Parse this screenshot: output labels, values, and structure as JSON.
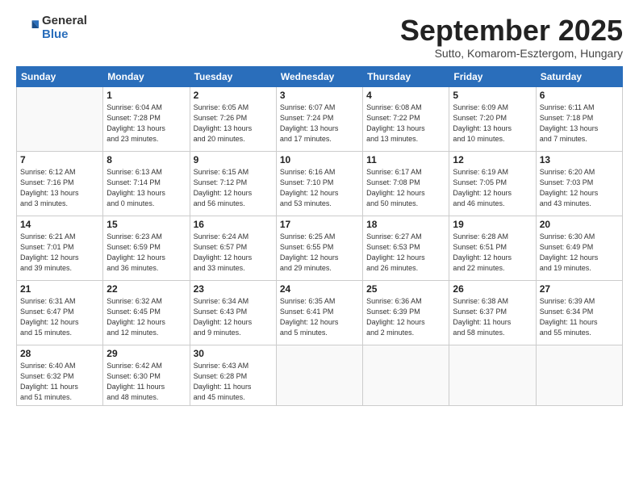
{
  "header": {
    "logo_general": "General",
    "logo_blue": "Blue",
    "month_title": "September 2025",
    "subtitle": "Sutto, Komarom-Esztergom, Hungary"
  },
  "days_of_week": [
    "Sunday",
    "Monday",
    "Tuesday",
    "Wednesday",
    "Thursday",
    "Friday",
    "Saturday"
  ],
  "weeks": [
    [
      {
        "day": "",
        "info": ""
      },
      {
        "day": "1",
        "info": "Sunrise: 6:04 AM\nSunset: 7:28 PM\nDaylight: 13 hours\nand 23 minutes."
      },
      {
        "day": "2",
        "info": "Sunrise: 6:05 AM\nSunset: 7:26 PM\nDaylight: 13 hours\nand 20 minutes."
      },
      {
        "day": "3",
        "info": "Sunrise: 6:07 AM\nSunset: 7:24 PM\nDaylight: 13 hours\nand 17 minutes."
      },
      {
        "day": "4",
        "info": "Sunrise: 6:08 AM\nSunset: 7:22 PM\nDaylight: 13 hours\nand 13 minutes."
      },
      {
        "day": "5",
        "info": "Sunrise: 6:09 AM\nSunset: 7:20 PM\nDaylight: 13 hours\nand 10 minutes."
      },
      {
        "day": "6",
        "info": "Sunrise: 6:11 AM\nSunset: 7:18 PM\nDaylight: 13 hours\nand 7 minutes."
      }
    ],
    [
      {
        "day": "7",
        "info": "Sunrise: 6:12 AM\nSunset: 7:16 PM\nDaylight: 13 hours\nand 3 minutes."
      },
      {
        "day": "8",
        "info": "Sunrise: 6:13 AM\nSunset: 7:14 PM\nDaylight: 13 hours\nand 0 minutes."
      },
      {
        "day": "9",
        "info": "Sunrise: 6:15 AM\nSunset: 7:12 PM\nDaylight: 12 hours\nand 56 minutes."
      },
      {
        "day": "10",
        "info": "Sunrise: 6:16 AM\nSunset: 7:10 PM\nDaylight: 12 hours\nand 53 minutes."
      },
      {
        "day": "11",
        "info": "Sunrise: 6:17 AM\nSunset: 7:08 PM\nDaylight: 12 hours\nand 50 minutes."
      },
      {
        "day": "12",
        "info": "Sunrise: 6:19 AM\nSunset: 7:05 PM\nDaylight: 12 hours\nand 46 minutes."
      },
      {
        "day": "13",
        "info": "Sunrise: 6:20 AM\nSunset: 7:03 PM\nDaylight: 12 hours\nand 43 minutes."
      }
    ],
    [
      {
        "day": "14",
        "info": "Sunrise: 6:21 AM\nSunset: 7:01 PM\nDaylight: 12 hours\nand 39 minutes."
      },
      {
        "day": "15",
        "info": "Sunrise: 6:23 AM\nSunset: 6:59 PM\nDaylight: 12 hours\nand 36 minutes."
      },
      {
        "day": "16",
        "info": "Sunrise: 6:24 AM\nSunset: 6:57 PM\nDaylight: 12 hours\nand 33 minutes."
      },
      {
        "day": "17",
        "info": "Sunrise: 6:25 AM\nSunset: 6:55 PM\nDaylight: 12 hours\nand 29 minutes."
      },
      {
        "day": "18",
        "info": "Sunrise: 6:27 AM\nSunset: 6:53 PM\nDaylight: 12 hours\nand 26 minutes."
      },
      {
        "day": "19",
        "info": "Sunrise: 6:28 AM\nSunset: 6:51 PM\nDaylight: 12 hours\nand 22 minutes."
      },
      {
        "day": "20",
        "info": "Sunrise: 6:30 AM\nSunset: 6:49 PM\nDaylight: 12 hours\nand 19 minutes."
      }
    ],
    [
      {
        "day": "21",
        "info": "Sunrise: 6:31 AM\nSunset: 6:47 PM\nDaylight: 12 hours\nand 15 minutes."
      },
      {
        "day": "22",
        "info": "Sunrise: 6:32 AM\nSunset: 6:45 PM\nDaylight: 12 hours\nand 12 minutes."
      },
      {
        "day": "23",
        "info": "Sunrise: 6:34 AM\nSunset: 6:43 PM\nDaylight: 12 hours\nand 9 minutes."
      },
      {
        "day": "24",
        "info": "Sunrise: 6:35 AM\nSunset: 6:41 PM\nDaylight: 12 hours\nand 5 minutes."
      },
      {
        "day": "25",
        "info": "Sunrise: 6:36 AM\nSunset: 6:39 PM\nDaylight: 12 hours\nand 2 minutes."
      },
      {
        "day": "26",
        "info": "Sunrise: 6:38 AM\nSunset: 6:37 PM\nDaylight: 11 hours\nand 58 minutes."
      },
      {
        "day": "27",
        "info": "Sunrise: 6:39 AM\nSunset: 6:34 PM\nDaylight: 11 hours\nand 55 minutes."
      }
    ],
    [
      {
        "day": "28",
        "info": "Sunrise: 6:40 AM\nSunset: 6:32 PM\nDaylight: 11 hours\nand 51 minutes."
      },
      {
        "day": "29",
        "info": "Sunrise: 6:42 AM\nSunset: 6:30 PM\nDaylight: 11 hours\nand 48 minutes."
      },
      {
        "day": "30",
        "info": "Sunrise: 6:43 AM\nSunset: 6:28 PM\nDaylight: 11 hours\nand 45 minutes."
      },
      {
        "day": "",
        "info": ""
      },
      {
        "day": "",
        "info": ""
      },
      {
        "day": "",
        "info": ""
      },
      {
        "day": "",
        "info": ""
      }
    ]
  ]
}
